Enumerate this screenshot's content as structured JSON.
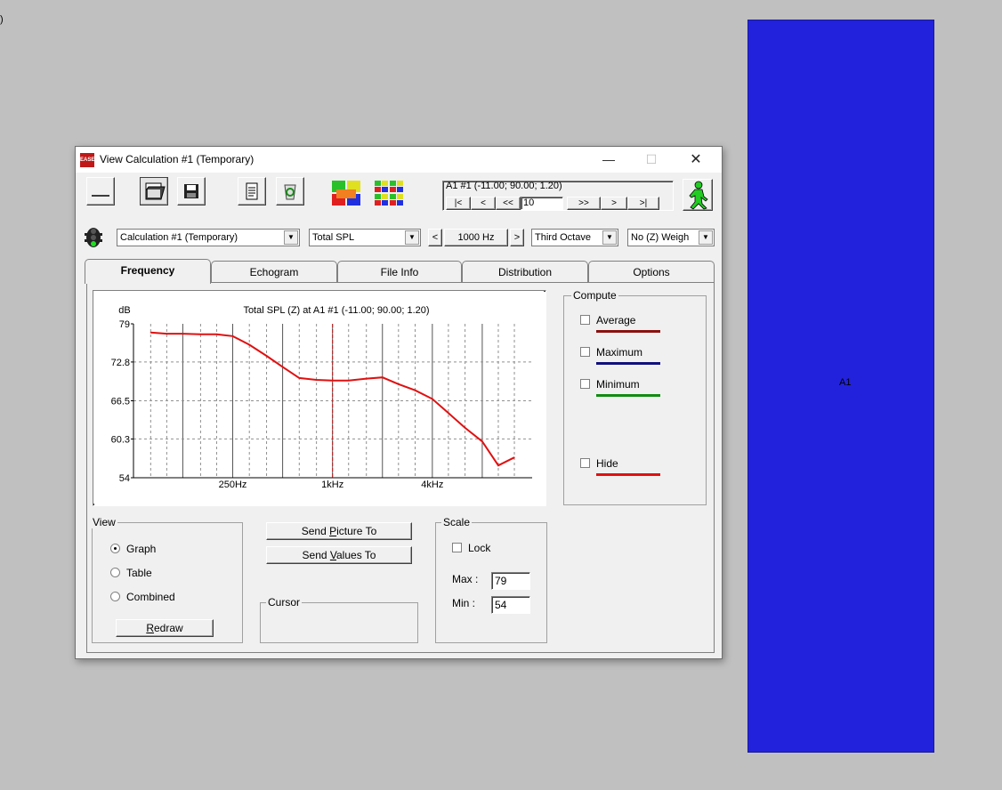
{
  "desktop": {
    "corner_text": ")",
    "panel_label": "A1",
    "panel_color": "#2222dd"
  },
  "window": {
    "title": "View Calculation #1 (Temporary)",
    "app_icon": "EASE",
    "controls": {
      "minimize": "—",
      "maximize": "☐",
      "close": "✕"
    }
  },
  "toolbar": {
    "position_text": "A1 #1  (-11.00; 90.00; 1.20)",
    "nav": {
      "first": "|<",
      "prev": "<",
      "prev_fast": "<<",
      "step": "10",
      "next_fast": ">>",
      "next": ">",
      "last": ">|"
    }
  },
  "selectors": {
    "calculation": "Calculation #1 (Temporary)",
    "quantity": "Total SPL",
    "frequency": "1000 Hz",
    "bandwidth": "Third Octave",
    "weighting": "No (Z) Weigh",
    "freq_prev": "<",
    "freq_next": ">"
  },
  "tabs": [
    {
      "label": "Frequency",
      "active": true
    },
    {
      "label": "Echogram",
      "active": false
    },
    {
      "label": "File Info",
      "active": false
    },
    {
      "label": "Distribution",
      "active": false
    },
    {
      "label": "Options",
      "active": false
    }
  ],
  "compute": {
    "title": "Compute",
    "average": {
      "label": "Average",
      "checked": false,
      "color": "#8b1010"
    },
    "maximum": {
      "label": "Maximum",
      "checked": false,
      "color": "#10107f"
    },
    "minimum": {
      "label": "Minimum",
      "checked": false,
      "color": "#108c10"
    },
    "hide": {
      "label": "Hide",
      "checked": false,
      "color": "#e01010"
    }
  },
  "view": {
    "title": "View",
    "options": [
      "Graph",
      "Table",
      "Combined"
    ],
    "selected": "Graph",
    "redraw": "Redraw"
  },
  "send": {
    "picture": "Send Picture To",
    "values": "Send Values To"
  },
  "cursor": {
    "title": "Cursor"
  },
  "scale": {
    "title": "Scale",
    "lock_label": "Lock",
    "lock_checked": false,
    "max_label": "Max :",
    "max_value": "79",
    "min_label": "Min :",
    "min_value": "54"
  },
  "chart_data": {
    "type": "line",
    "title": "Total SPL (Z) at A1 #1  (-11.00; 90.00; 1.20)",
    "ylabel": "dB",
    "xlabel": "",
    "x_scale": "log",
    "xlim": [
      63,
      16000
    ],
    "ylim": [
      54,
      79
    ],
    "y_ticks": [
      "79",
      "72.8",
      "66.5",
      "60.3",
      "54"
    ],
    "y_tick_values": [
      79,
      72.8,
      66.5,
      60.3,
      54
    ],
    "x_tick_labels": [
      "250Hz",
      "1kHz",
      "4kHz"
    ],
    "x_tick_values": [
      250,
      1000,
      4000
    ],
    "cursor_frequency": 1000,
    "cursor_color": "#c01818",
    "grid": true,
    "series": [
      {
        "color": "#e01010",
        "x": [
          80,
          100,
          125,
          160,
          200,
          250,
          315,
          400,
          500,
          630,
          800,
          1000,
          1250,
          1600,
          2000,
          2500,
          3150,
          4000,
          5000,
          6300,
          8000,
          10000,
          12500
        ],
        "values": [
          77.6,
          77.4,
          77.4,
          77.3,
          77.3,
          77.0,
          75.6,
          73.8,
          72.0,
          70.2,
          69.9,
          69.8,
          69.8,
          70.1,
          70.3,
          69.2,
          68.2,
          66.8,
          64.5,
          62.1,
          59.9,
          56.0,
          57.3
        ]
      }
    ]
  }
}
